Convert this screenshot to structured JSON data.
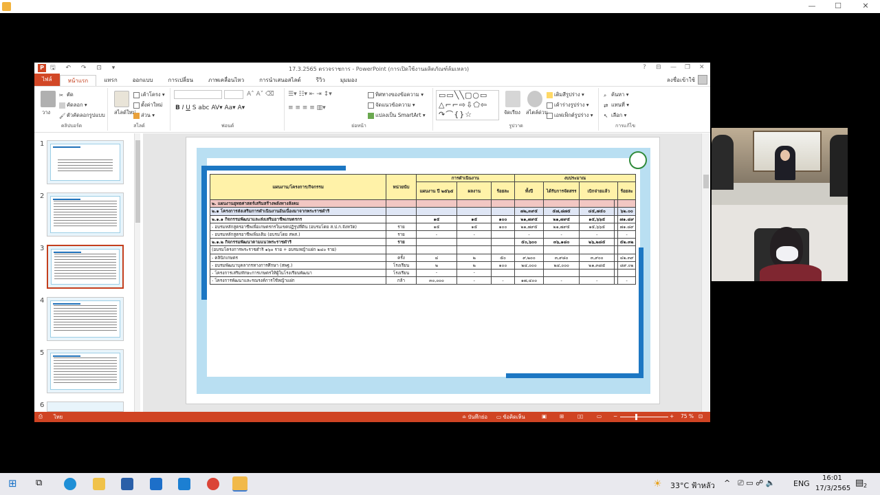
{
  "powerpoint": {
    "title": "17.3.2565 ตรวจราชการ - PowerPoint (การเปิดใช้งานผลิตภัณฑ์ล้มเหลว)",
    "tabs": [
      "ไฟล์",
      "หน้าแรก",
      "แทรก",
      "ออกแบบ",
      "การเปลี่ยน",
      "ภาพเคลื่อนไหว",
      "การนำเสนอสไลด์",
      "รีวิว",
      "มุมมอง"
    ],
    "active_tab": "หน้าแรก",
    "sign_in": "ลงชื่อเข้าใช้",
    "ribbon": {
      "clipboard": {
        "label": "คลิปบอร์ด",
        "paste": "วาง",
        "cut": "ตัด",
        "copy": "คัดลอก",
        "format_painter": "ตัวคัดลอกรูปแบบ"
      },
      "slides": {
        "label": "สไลด์",
        "new_slide": "สไลด์ใหม่",
        "layout": "เค้าโครง",
        "reset": "ตั้งค่าใหม่",
        "section": "ส่วน"
      },
      "font": {
        "label": "ฟอนต์"
      },
      "paragraph": {
        "label": "ย่อหน้า",
        "text_direction": "ทิศทางของข้อความ",
        "align_text": "จัดแนวข้อความ",
        "smartart": "แปลงเป็น SmartArt"
      },
      "drawing": {
        "label": "รูปวาด",
        "arrange": "จัดเรียง",
        "quick_styles": "สไตล์ด่วน",
        "shape_fill": "เติมสีรูปร่าง",
        "shape_outline": "เค้าร่างรูปร่าง",
        "shape_effects": "เอฟเฟ็กต์รูปร่าง"
      },
      "editing": {
        "label": "การแก้ไข",
        "find": "ค้นหา",
        "replace": "แทนที่",
        "select": "เลือก"
      }
    },
    "thumbnails": [
      {
        "num": "1"
      },
      {
        "num": "2"
      },
      {
        "num": "3",
        "selected": true
      },
      {
        "num": "4"
      },
      {
        "num": "5"
      },
      {
        "num": "6"
      }
    ],
    "status": {
      "language": "ไทย",
      "notes": "บันทึกย่อ",
      "comments": "ข้อคิดเห็น",
      "zoom": "75 %"
    }
  },
  "slide_table": {
    "headers": {
      "item": "แผนงาน/โครงการ/กิจกรรม",
      "unit": "หน่วยนับ",
      "performance": "การดำเนินงาน",
      "budget": "งบประมาณ",
      "plan": "แผนงาน ปี ๒๕๖๕",
      "result": "ผลงาน",
      "percent": "ร้อยละ",
      "full_year": "ทั้งปี",
      "allocated": "ได้รับการจัดสรร",
      "disbursed": "เบิกจ่ายแล้ว",
      "percent2": "ร้อยละ"
    },
    "rows": [
      {
        "type": "sec",
        "cells": [
          "๒. แผนงานยุทธศาสตร์เสริมสร้างพลังทางสังคม",
          "",
          "",
          "",
          "",
          "",
          "",
          "",
          "",
          ""
        ]
      },
      {
        "type": "proj",
        "cells": [
          "๒.๑ โครงการส่งเสริมการดำเนินงานอันเนื่องมาจากพระราชดำริ",
          "",
          "",
          "",
          "",
          "๗๒,๓๙๕",
          "๕๗,๘๗๕",
          "๔๕,๗๕๐",
          "",
          "๖๒.๐๐"
        ]
      },
      {
        "type": "sub",
        "cells": [
          "๒.๑.๑ กิจกรรมพัฒนาและส่งเสริมอาชีพเกษตรกร",
          "",
          "๑๕",
          "๑๕",
          "๑๐๐",
          "๒๑,๗๙๕",
          "๒๑,๗๙๕",
          "๑๕,๖๖๕",
          "",
          "๗๑.๘๙"
        ]
      },
      {
        "type": "row",
        "cells": [
          "- อบรมหลักสูตรอาชีพเพื่อเกษตรกรในเขตปฏิรูปที่ดิน (อบรมโดย ส.ป.ก.จังหวัด)",
          "ราย",
          "๑๕",
          "๑๕",
          "๑๐๐",
          "๒๑,๗๙๕",
          "๒๑,๗๙๕",
          "๑๕,๖๖๕",
          "",
          "๗๑.๘๙"
        ]
      },
      {
        "type": "row",
        "cells": [
          "- อบรมหลักสูตรอาชีพเพิ่มเติม (อบรมโดย สพส.)",
          "ราย",
          "-",
          "-",
          "",
          "-",
          "-",
          "-",
          "",
          "-"
        ]
      },
      {
        "type": "sub",
        "cells": [
          "๒.๑.๒ กิจกรรมพัฒนาตามแนวพระราชดำริ",
          "ราย",
          "",
          "",
          "",
          "๕๐,๖๐๐",
          "๓๖,๑๘๐",
          "๒๖,๒๘๕",
          "",
          "๕๒.๓๒"
        ]
      },
      {
        "type": "row",
        "cells": [
          "(อบรมโครงการพระราชดำริ ๑๖๐ ราย + อบรมหญ้าแฝก ๒๔๐ ราย)",
          "",
          "",
          "",
          "",
          "",
          "",
          "",
          "",
          ""
        ]
      },
      {
        "type": "row",
        "cells": [
          "- คลินิกเกษตร",
          "ครั้ง",
          "๔",
          "๒",
          "๕๐",
          "๙,๒๐๐",
          "๓,๙๘๐",
          "๓,๙๐๐",
          "",
          "๔๒.๓๙"
        ]
      },
      {
        "type": "row",
        "cells": [
          "- อบรมพัฒนาบุคลากรทางการศึกษา (สพฐ.)",
          "โรงเรียน",
          "๒",
          "๒",
          "๑๐๐",
          "๒๔,๐๐๐",
          "๒๔,๐๐๐",
          "๒๑,๓๘๕",
          "",
          "๘๙.๐๒"
        ]
      },
      {
        "type": "row",
        "cells": [
          "- โครงการเสริมทักษะการเกษตรให้ผู้ในโรงเรียนพัฒนา",
          "โรงเรียน",
          "-",
          "-",
          "",
          "",
          "",
          "",
          "",
          ""
        ]
      },
      {
        "type": "row",
        "cells": [
          "- โครงการพัฒนาและรณรงค์การใช้หญ้าแฝก",
          "กล้า",
          "๓๐,๐๐๐",
          "-",
          "-",
          "๑๗,๔๐๐",
          "-",
          "-",
          "",
          "-"
        ]
      }
    ]
  },
  "taskbar": {
    "weather": "33°C ฟ้าหลัว",
    "lang": "ENG",
    "time": "16:01",
    "date": "17/3/2565",
    "notif_count": "2"
  }
}
